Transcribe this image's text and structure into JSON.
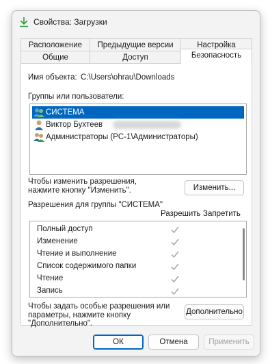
{
  "window": {
    "title": "Свойства: Загрузки",
    "icon": "download-arrow-icon",
    "accent": "#0067c0"
  },
  "tabs": {
    "row1": [
      "Расположение",
      "Предыдущие версии",
      "Настройка"
    ],
    "row2": [
      "Общие",
      "Доступ",
      "Безопасность"
    ],
    "active": "Безопасность"
  },
  "security": {
    "object_label": "Имя объекта:",
    "object_path": "C:\\Users\\ohrau\\Downloads",
    "groups_label": "Группы или пользователи:",
    "groups": [
      {
        "name": "СИСТЕМА",
        "icon": "user-group-icon",
        "selected": true
      },
      {
        "name": "Виктор Бухтеев",
        "icon": "user-icon",
        "selected": false
      },
      {
        "name": "Администраторы (PC-1\\Администраторы)",
        "icon": "user-group-icon",
        "selected": false
      }
    ],
    "change_hint_line1": "Чтобы изменить разрешения,",
    "change_hint_line2": "нажмите кнопку \"Изменить\".",
    "change_button": "Изменить...",
    "permissions_label": "Разрешения для группы \"СИСТЕМА\"",
    "allow_header": "Разрешить",
    "deny_header": "Запретить",
    "permissions": [
      {
        "name": "Полный доступ",
        "allow": true,
        "deny": false
      },
      {
        "name": "Изменение",
        "allow": true,
        "deny": false
      },
      {
        "name": "Чтение и выполнение",
        "allow": true,
        "deny": false
      },
      {
        "name": "Список содержимого папки",
        "allow": true,
        "deny": false
      },
      {
        "name": "Чтение",
        "allow": true,
        "deny": false
      },
      {
        "name": "Запись",
        "allow": true,
        "deny": false
      }
    ],
    "advanced_hint_line1": "Чтобы задать особые разрешения или",
    "advanced_hint_line2": "параметры, нажмите кнопку",
    "advanced_hint_line3": "\"Дополнительно\".",
    "advanced_button": "Дополнительно"
  },
  "footer": {
    "ok": "ОК",
    "cancel": "Отмена",
    "apply": "Применить"
  }
}
